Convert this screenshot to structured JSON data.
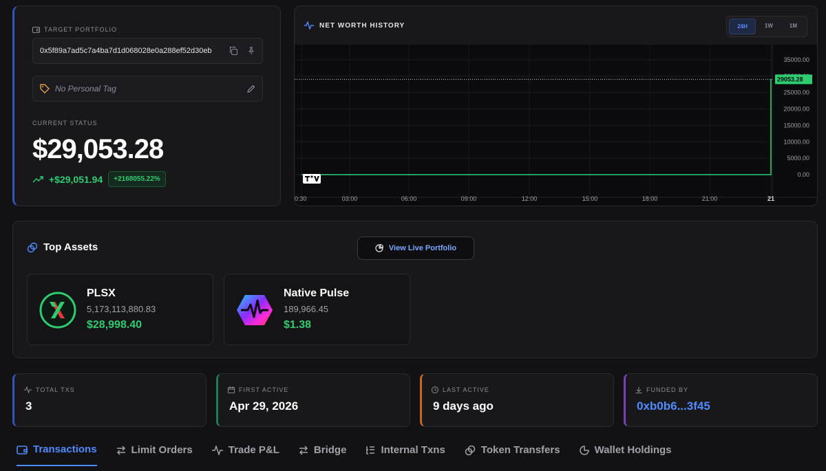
{
  "portfolio": {
    "target_label": "TARGET PORTFOLIO",
    "address": "0x5f89a7ad5c7a4ba7d1d068028e0a288ef52d30eb",
    "tag_placeholder": "No Personal Tag",
    "status_label": "CURRENT STATUS",
    "balance": "$29,053.28",
    "change_amount": "+$29,051.94",
    "change_pct": "+2168055.22%"
  },
  "chart": {
    "title": "NET WORTH HISTORY",
    "ranges": [
      "24H",
      "1W",
      "1M"
    ],
    "active_range": "24H",
    "price_tag": "29053.28",
    "watermark": "TV"
  },
  "chart_data": {
    "type": "line",
    "x": [
      "00:30",
      "03:00",
      "06:00",
      "09:00",
      "12:00",
      "15:00",
      "18:00",
      "21:00",
      "21"
    ],
    "x_ticks": [
      "0:30",
      "03:00",
      "06:00",
      "09:00",
      "12:00",
      "15:00",
      "18:00",
      "21:00",
      "21"
    ],
    "series": [
      {
        "values": [
          0,
          0,
          0,
          0,
          0,
          0,
          0,
          0,
          29053.28
        ]
      }
    ],
    "y_ticks": [
      "35000.00",
      "30000.00",
      "25000.00",
      "20000.00",
      "15000.00",
      "10000.00",
      "5000.00",
      "0.00"
    ],
    "ylim": [
      0,
      35000
    ],
    "last_value": 29053.28,
    "line_color": "#2ecc71",
    "grid": true
  },
  "assets": {
    "title": "Top Assets",
    "live_button": "View Live Portfolio",
    "items": [
      {
        "name": "PLSX",
        "quantity": "5,173,113,880.83",
        "value": "$28,998.40"
      },
      {
        "name": "Native Pulse",
        "quantity": "189,966.45",
        "value": "$1.38"
      }
    ]
  },
  "stats": [
    {
      "label": "TOTAL TXS",
      "value": "3",
      "accent": "#3654b8"
    },
    {
      "label": "FIRST ACTIVE",
      "value": "Apr 29, 2026",
      "accent": "#1f7a55"
    },
    {
      "label": "LAST ACTIVE",
      "value": "9 days ago",
      "accent": "#c26a1f"
    },
    {
      "label": "FUNDED BY",
      "value": "0xb0b6...3f45",
      "accent": "#7b3fb8"
    }
  ],
  "tabs": [
    "Transactions",
    "Limit Orders",
    "Trade P&L",
    "Bridge",
    "Internal Txns",
    "Token Transfers",
    "Wallet Holdings"
  ],
  "active_tab": "Transactions",
  "colors": {
    "positive": "#2ecc71",
    "accent": "#4f8bff",
    "background": "#121214"
  }
}
